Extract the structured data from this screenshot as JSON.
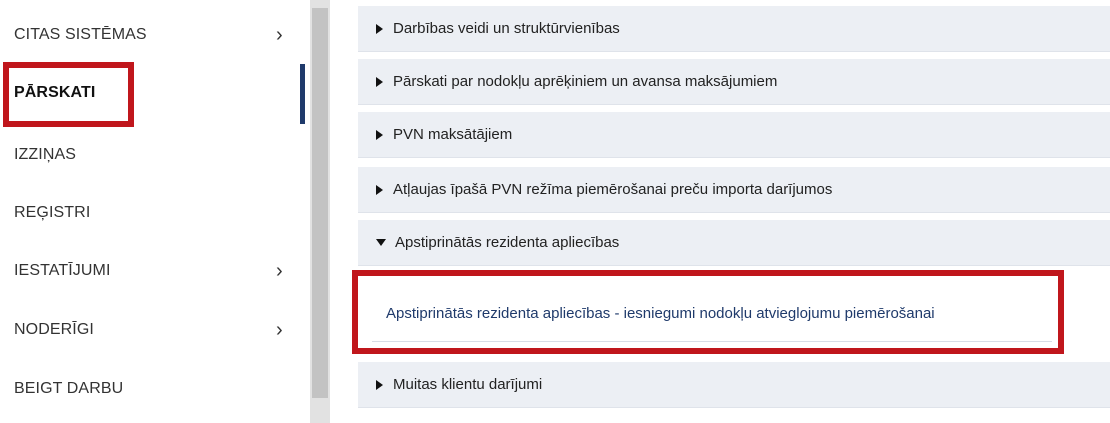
{
  "sidebar": {
    "items": [
      {
        "label": "CITAS SISTĒMAS",
        "has_submenu": true
      },
      {
        "label": "PĀRSKATI",
        "has_submenu": false,
        "active": true
      },
      {
        "label": "IZZIŅAS",
        "has_submenu": false
      },
      {
        "label": "REĢISTRI",
        "has_submenu": false
      },
      {
        "label": "IESTATĪJUMI",
        "has_submenu": true
      },
      {
        "label": "NODERĪGI",
        "has_submenu": true
      },
      {
        "label": "BEIGT DARBU",
        "has_submenu": false
      }
    ],
    "chevron": "›"
  },
  "accordion": [
    {
      "title": "Darbības veidi un struktūrvienības",
      "expanded": false
    },
    {
      "title": "Pārskati par nodokļu aprēķiniem un avansa maksājumiem",
      "expanded": false
    },
    {
      "title": "PVN maksātājiem",
      "expanded": false
    },
    {
      "title": "Atļaujas īpašā PVN režīma piemērošanai preču importa darījumos",
      "expanded": false
    },
    {
      "title": "Apstiprinātās rezidenta apliecības",
      "expanded": true,
      "links": [
        "Apstiprinātās rezidenta apliecības - iesniegumi nodokļu atvieglojumu piemērošanai"
      ]
    },
    {
      "title": "Muitas klientu darījumi",
      "expanded": false
    }
  ],
  "colors": {
    "highlight": "#c0161c",
    "active_bar": "#1f3a6b",
    "panel_bg": "#eceff4",
    "link": "#1f3a6b"
  }
}
